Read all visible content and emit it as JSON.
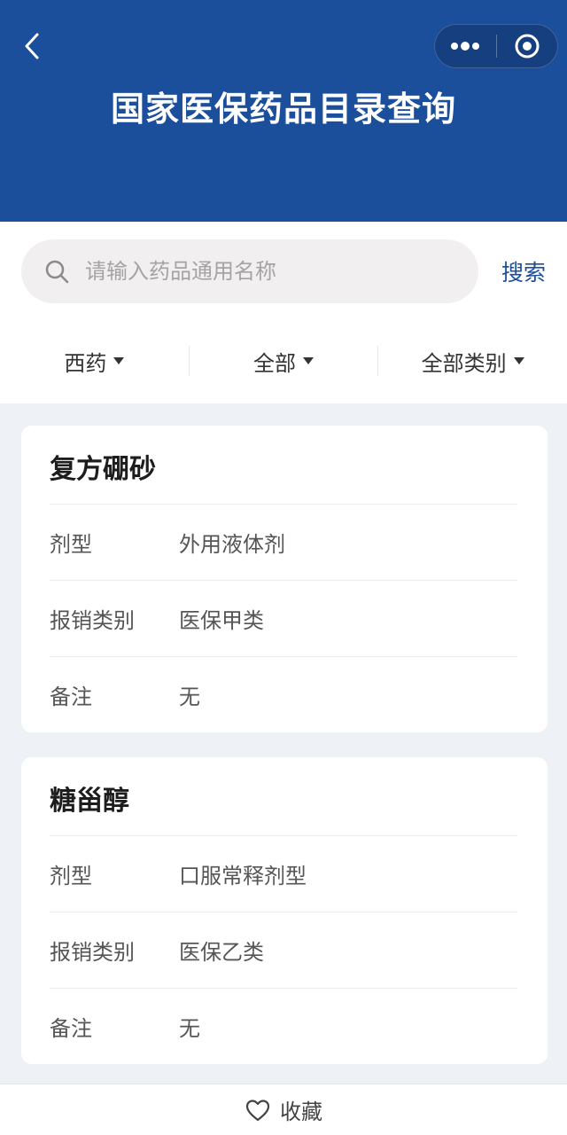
{
  "header": {
    "title": "国家医保药品目录查询",
    "color": "#1b4e9b"
  },
  "search": {
    "placeholder": "请输入药品通用名称",
    "value": "",
    "button_label": "搜索"
  },
  "filters": [
    {
      "label": "西药"
    },
    {
      "label": "全部"
    },
    {
      "label": "全部类别"
    }
  ],
  "drugs": [
    {
      "name": "复方硼砂",
      "rows": [
        {
          "label": "剂型",
          "value": "外用液体剂"
        },
        {
          "label": "报销类别",
          "value": "医保甲类"
        },
        {
          "label": "备注",
          "value": "无"
        }
      ]
    },
    {
      "name": "糖甾醇",
      "rows": [
        {
          "label": "剂型",
          "value": "口服常释剂型"
        },
        {
          "label": "报销类别",
          "value": "医保乙类"
        },
        {
          "label": "备注",
          "value": "无"
        }
      ]
    }
  ],
  "bottom": {
    "favorite_label": "收藏"
  },
  "icons": {
    "back": "chevron-left-icon",
    "more": "more-dots-icon",
    "close": "target-circle-icon",
    "search": "search-icon",
    "favorite": "heart-outline-icon"
  }
}
